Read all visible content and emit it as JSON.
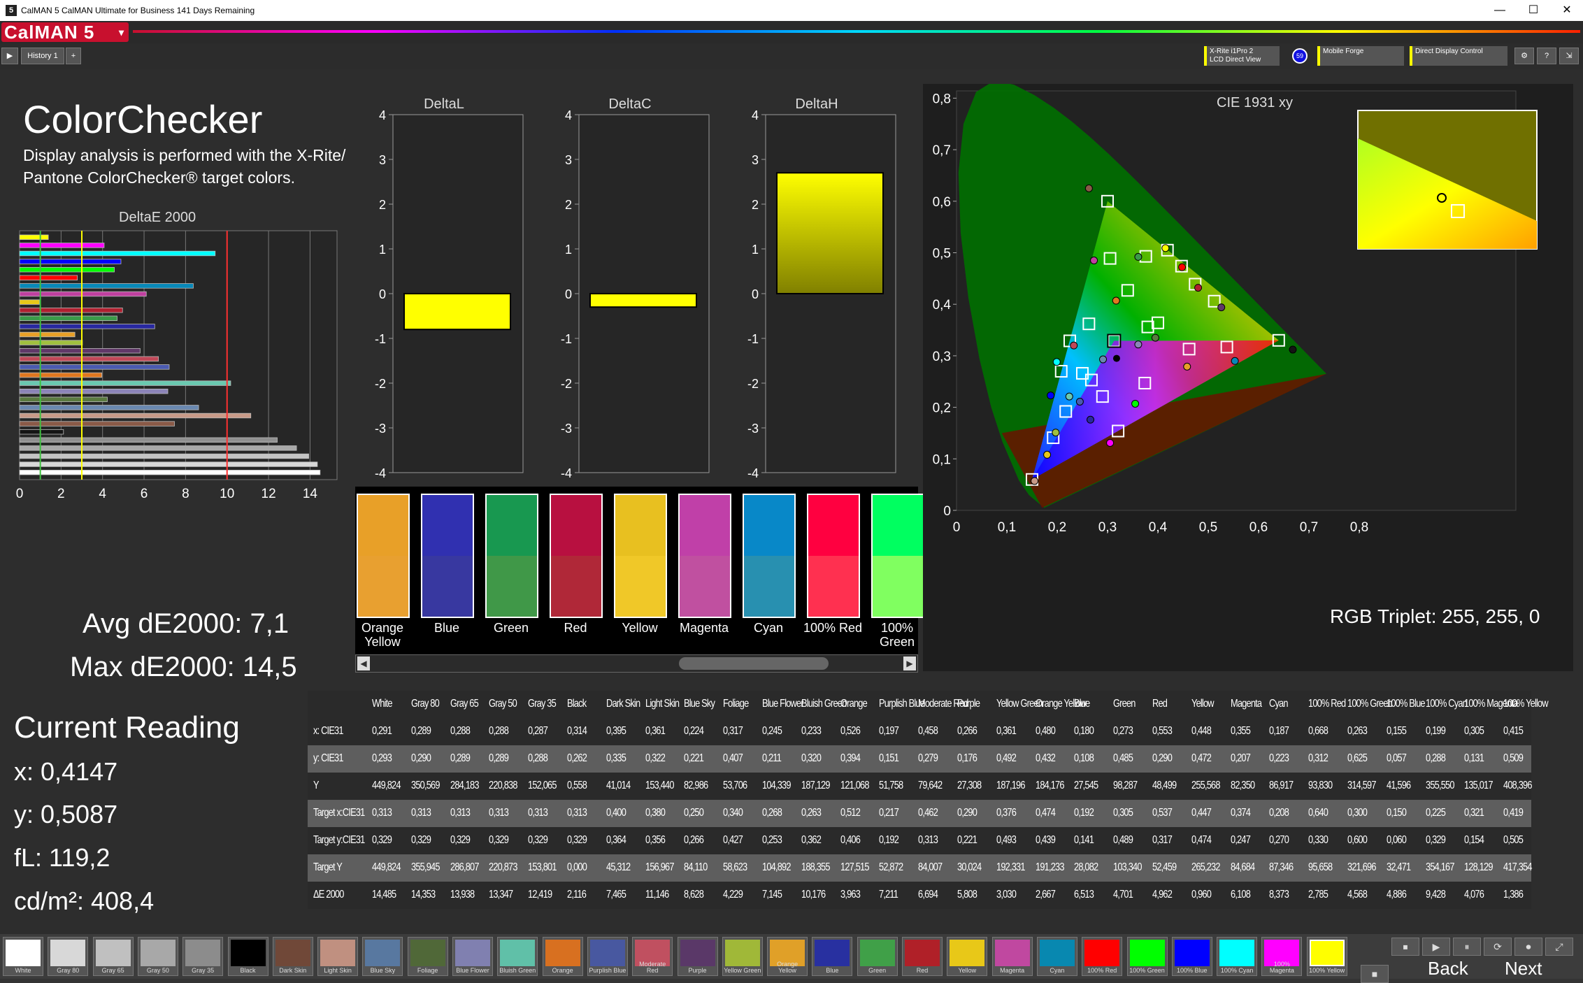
{
  "window": {
    "title": "CalMAN 5 CalMAN Ultimate for Business 141 Days Remaining",
    "minimize": "—",
    "maximize": "☐",
    "close": "✕"
  },
  "brand": {
    "name": "CalMAN 5",
    "dropdown": "▾"
  },
  "toolbar": {
    "play": "▶",
    "tab": "History 1",
    "add": "+",
    "devices": [
      {
        "line1": "X-Rite i1Pro 2",
        "line2": "LCD Direct View"
      },
      {
        "line1": "Mobile Forge",
        "line2": ""
      },
      {
        "line1": "Direct Display Control",
        "line2": ""
      }
    ],
    "badge": "59",
    "gear": "⚙",
    "help": "?",
    "pin": "⇲"
  },
  "left": {
    "title": "ColorChecker",
    "desc": "Display analysis is performed with the X-Rite/ Pantone ColorChecker® target colors.",
    "chart_title": "DeltaE 2000",
    "avg": "Avg dE2000: 7,1",
    "max": "Max dE2000: 14,5",
    "current": "Current Reading",
    "x": "x: 0,4147",
    "y": "y: 0,5087",
    "fl": "fL: 119,2",
    "cd": "cd/m²: 408,4"
  },
  "chart_data": [
    {
      "type": "bar",
      "title": "DeltaE 2000",
      "orientation": "horizontal",
      "xlim": [
        0,
        15
      ],
      "xticks": [
        0,
        2,
        4,
        6,
        8,
        10,
        12,
        14
      ],
      "reference_lines": [
        1,
        3,
        10
      ],
      "categories": [
        "White",
        "Gray 80",
        "Gray 65",
        "Gray 50",
        "Gray 35",
        "Black",
        "Dark Skin",
        "Light Skin",
        "Blue Sky",
        "Foliage",
        "Blue Flower",
        "Bluish Green",
        "Orange",
        "Purplish Blue",
        "Moderate Red",
        "Purple",
        "Yellow Green",
        "Orange Yellow",
        "Blue",
        "Green",
        "Red",
        "Yellow",
        "Magenta",
        "Cyan",
        "100% Red",
        "100% Green",
        "100% Blue",
        "100% Cyan",
        "100% Magenta",
        "100% Yellow"
      ],
      "values": [
        14.485,
        14.353,
        13.938,
        13.347,
        12.419,
        2.116,
        7.465,
        11.146,
        8.628,
        4.229,
        7.145,
        10.176,
        3.963,
        7.211,
        6.694,
        5.808,
        3.03,
        2.667,
        6.513,
        4.701,
        4.962,
        0.96,
        6.108,
        8.373,
        2.785,
        4.568,
        4.886,
        9.428,
        4.076,
        1.386
      ],
      "colors": [
        "#ffffff",
        "#d8d8d8",
        "#c4c4c4",
        "#a8a8a8",
        "#909090",
        "#141414",
        "#8a5a48",
        "#c89a88",
        "#6a88b0",
        "#5a7a40",
        "#8c84b8",
        "#6ac8b0",
        "#e07820",
        "#4a5ab0",
        "#c04858",
        "#603868",
        "#a0c040",
        "#e8a028",
        "#2828a0",
        "#3a9a48",
        "#b02030",
        "#e8c818",
        "#c040a0",
        "#0888b8",
        "#ff0000",
        "#00ff00",
        "#0000ff",
        "#00ffff",
        "#ff00ff",
        "#ffff00"
      ]
    },
    {
      "type": "bar",
      "title": "DeltaL",
      "ylim": [
        -4,
        4
      ],
      "values": [
        -0.8
      ],
      "color": "#ffff00"
    },
    {
      "type": "bar",
      "title": "DeltaC",
      "ylim": [
        -4,
        4
      ],
      "values": [
        -0.3
      ],
      "color": "#ffff00"
    },
    {
      "type": "bar",
      "title": "DeltaH",
      "ylim": [
        -4,
        4
      ],
      "values": [
        2.7
      ],
      "color": "#ffff00"
    },
    {
      "type": "scatter",
      "title": "CIE 1931 xy",
      "xlim": [
        0,
        0.8
      ],
      "ylim": [
        0,
        0.8
      ],
      "xticks": [
        "0",
        "0,1",
        "0,2",
        "0,3",
        "0,4",
        "0,5",
        "0,6",
        "0,7",
        "0,8"
      ],
      "yticks": [
        "0",
        "0,1",
        "0,2",
        "0,3",
        "0,4",
        "0,5",
        "0,6",
        "0,7",
        "0,8"
      ],
      "targets": [
        [
          0.64,
          0.33
        ],
        [
          0.3,
          0.6
        ],
        [
          0.15,
          0.06
        ],
        [
          0.313,
          0.329
        ],
        [
          0.4,
          0.364
        ],
        [
          0.38,
          0.356
        ],
        [
          0.25,
          0.266
        ],
        [
          0.34,
          0.427
        ],
        [
          0.268,
          0.253
        ],
        [
          0.263,
          0.362
        ],
        [
          0.512,
          0.406
        ],
        [
          0.217,
          0.192
        ],
        [
          0.462,
          0.313
        ],
        [
          0.29,
          0.221
        ],
        [
          0.376,
          0.493
        ],
        [
          0.474,
          0.439
        ],
        [
          0.192,
          0.141
        ],
        [
          0.305,
          0.489
        ],
        [
          0.537,
          0.317
        ],
        [
          0.447,
          0.474
        ],
        [
          0.374,
          0.247
        ],
        [
          0.208,
          0.27
        ],
        [
          0.225,
          0.329
        ],
        [
          0.321,
          0.154
        ],
        [
          0.419,
          0.505
        ]
      ],
      "measured": [
        [
          0.668,
          0.312
        ],
        [
          0.263,
          0.625
        ],
        [
          0.155,
          0.057
        ],
        [
          0.291,
          0.293
        ],
        [
          0.395,
          0.335
        ],
        [
          0.361,
          0.322
        ],
        [
          0.224,
          0.221
        ],
        [
          0.317,
          0.407
        ],
        [
          0.245,
          0.211
        ],
        [
          0.233,
          0.32
        ],
        [
          0.526,
          0.394
        ],
        [
          0.197,
          0.151
        ],
        [
          0.458,
          0.279
        ],
        [
          0.266,
          0.176
        ],
        [
          0.361,
          0.492
        ],
        [
          0.48,
          0.432
        ],
        [
          0.18,
          0.108
        ],
        [
          0.273,
          0.485
        ],
        [
          0.553,
          0.29
        ],
        [
          0.448,
          0.472
        ],
        [
          0.355,
          0.207
        ],
        [
          0.187,
          0.223
        ],
        [
          0.199,
          0.288
        ],
        [
          0.305,
          0.131
        ],
        [
          0.415,
          0.509
        ]
      ],
      "current": [
        0.4147,
        0.5087
      ],
      "triplet": "RGB Triplet: 255, 255, 0"
    }
  ],
  "delta_titles": [
    "DeltaL",
    "DeltaC",
    "DeltaH"
  ],
  "delta_ticks": [
    "4",
    "3",
    "2",
    "1",
    "0",
    "-1",
    "-2",
    "-3",
    "-4"
  ],
  "swatches": [
    {
      "label": "Orange Yellow",
      "top": "#e8a028",
      "bot": "#e8a030"
    },
    {
      "label": "Blue",
      "top": "#3030b0",
      "bot": "#3838a0"
    },
    {
      "label": "Green",
      "top": "#189850",
      "bot": "#409848"
    },
    {
      "label": "Red",
      "top": "#b81040",
      "bot": "#b02838"
    },
    {
      "label": "Yellow",
      "top": "#e8c020",
      "bot": "#f0c828"
    },
    {
      "label": "Magenta",
      "top": "#c040a8",
      "bot": "#c050a0"
    },
    {
      "label": "Cyan",
      "top": "#0888c8",
      "bot": "#2890b0"
    },
    {
      "label": "100% Red",
      "top": "#ff0040",
      "bot": "#ff3050"
    },
    {
      "label": "100% Green",
      "top": "#00ff60",
      "bot": "#80ff60"
    }
  ],
  "table": {
    "headers": [
      "White",
      "Gray 80",
      "Gray 65",
      "Gray 50",
      "Gray 35",
      "Black",
      "Dark Skin",
      "Light Skin",
      "Blue Sky",
      "Foliage",
      "Blue Flower",
      "Bluish Green",
      "Orange",
      "Purplish Blue",
      "Moderate Red",
      "Purple",
      "Yellow Green",
      "Orange Yellow",
      "Blue",
      "Green",
      "Red",
      "Yellow",
      "Magenta",
      "Cyan",
      "100% Red",
      "100% Green",
      "100% Blue",
      "100% Cyan",
      "100% Magenta",
      "100% Yellow"
    ],
    "rows": [
      {
        "label": "x: CIE31",
        "values": [
          "0,291",
          "0,289",
          "0,288",
          "0,288",
          "0,287",
          "0,314",
          "0,395",
          "0,361",
          "0,224",
          "0,317",
          "0,245",
          "0,233",
          "0,526",
          "0,197",
          "0,458",
          "0,266",
          "0,361",
          "0,480",
          "0,180",
          "0,273",
          "0,553",
          "0,448",
          "0,355",
          "0,187",
          "0,668",
          "0,263",
          "0,155",
          "0,199",
          "0,305",
          "0,415"
        ]
      },
      {
        "label": "y: CIE31",
        "values": [
          "0,293",
          "0,290",
          "0,289",
          "0,289",
          "0,288",
          "0,262",
          "0,335",
          "0,322",
          "0,221",
          "0,407",
          "0,211",
          "0,320",
          "0,394",
          "0,151",
          "0,279",
          "0,176",
          "0,492",
          "0,432",
          "0,108",
          "0,485",
          "0,290",
          "0,472",
          "0,207",
          "0,223",
          "0,312",
          "0,625",
          "0,057",
          "0,288",
          "0,131",
          "0,509"
        ]
      },
      {
        "label": "Y",
        "values": [
          "449,824",
          "350,569",
          "284,183",
          "220,838",
          "152,065",
          "0,558",
          "41,014",
          "153,440",
          "82,986",
          "53,706",
          "104,339",
          "187,129",
          "121,068",
          "51,758",
          "79,642",
          "27,308",
          "187,196",
          "184,176",
          "27,545",
          "98,287",
          "48,499",
          "255,568",
          "82,350",
          "86,917",
          "93,830",
          "314,597",
          "41,596",
          "355,550",
          "135,017",
          "408,396"
        ]
      },
      {
        "label": "Target x:CIE31",
        "values": [
          "0,313",
          "0,313",
          "0,313",
          "0,313",
          "0,313",
          "0,313",
          "0,400",
          "0,380",
          "0,250",
          "0,340",
          "0,268",
          "0,263",
          "0,512",
          "0,217",
          "0,462",
          "0,290",
          "0,376",
          "0,474",
          "0,192",
          "0,305",
          "0,537",
          "0,447",
          "0,374",
          "0,208",
          "0,640",
          "0,300",
          "0,150",
          "0,225",
          "0,321",
          "0,419"
        ]
      },
      {
        "label": "Target y:CIE31",
        "values": [
          "0,329",
          "0,329",
          "0,329",
          "0,329",
          "0,329",
          "0,329",
          "0,364",
          "0,356",
          "0,266",
          "0,427",
          "0,253",
          "0,362",
          "0,406",
          "0,192",
          "0,313",
          "0,221",
          "0,493",
          "0,439",
          "0,141",
          "0,489",
          "0,317",
          "0,474",
          "0,247",
          "0,270",
          "0,330",
          "0,600",
          "0,060",
          "0,329",
          "0,154",
          "0,505"
        ]
      },
      {
        "label": "Target Y",
        "values": [
          "449,824",
          "355,945",
          "286,807",
          "220,873",
          "153,801",
          "0,000",
          "45,312",
          "156,967",
          "84,110",
          "58,623",
          "104,892",
          "188,355",
          "127,515",
          "52,872",
          "84,007",
          "30,024",
          "192,331",
          "191,233",
          "28,082",
          "103,340",
          "52,459",
          "265,232",
          "84,684",
          "87,346",
          "95,658",
          "321,696",
          "32,471",
          "354,167",
          "128,129",
          "417,354"
        ]
      },
      {
        "label": "ΔE 2000",
        "values": [
          "14,485",
          "14,353",
          "13,938",
          "13,347",
          "12,419",
          "2,116",
          "7,465",
          "11,146",
          "8,628",
          "4,229",
          "7,145",
          "10,176",
          "3,963",
          "7,211",
          "6,694",
          "5,808",
          "3,030",
          "2,667",
          "6,513",
          "4,701",
          "4,962",
          "0,960",
          "6,108",
          "8,373",
          "2,785",
          "4,568",
          "4,886",
          "9,428",
          "4,076",
          "1,386"
        ]
      }
    ]
  },
  "patches": [
    {
      "label": "White",
      "color": "#ffffff"
    },
    {
      "label": "Gray 80",
      "color": "#d8d8d8"
    },
    {
      "label": "Gray 65",
      "color": "#c0c0c0"
    },
    {
      "label": "Gray 50",
      "color": "#a8a8a8"
    },
    {
      "label": "Gray 35",
      "color": "#8c8c8c"
    },
    {
      "label": "Black",
      "color": "#000000"
    },
    {
      "label": "Dark Skin",
      "color": "#704838"
    },
    {
      "label": "Light Skin",
      "color": "#c09080"
    },
    {
      "label": "Blue Sky",
      "color": "#5878a0"
    },
    {
      "label": "Foliage",
      "color": "#506838"
    },
    {
      "label": "Blue Flower",
      "color": "#8080b0"
    },
    {
      "label": "Bluish Green",
      "color": "#60c0a8"
    },
    {
      "label": "Orange",
      "color": "#d87020"
    },
    {
      "label": "Purplish Blue",
      "color": "#4858a0"
    },
    {
      "label": "Moderate Red",
      "color": "#c05060"
    },
    {
      "label": "Purple",
      "color": "#5a3868"
    },
    {
      "label": "Yellow Green",
      "color": "#a0b838"
    },
    {
      "label": "Orange Yellow",
      "color": "#e0a028"
    },
    {
      "label": "Blue",
      "color": "#2830a0"
    },
    {
      "label": "Green",
      "color": "#40a048"
    },
    {
      "label": "Red",
      "color": "#b02028"
    },
    {
      "label": "Yellow",
      "color": "#e8c818"
    },
    {
      "label": "Magenta",
      "color": "#c048a0"
    },
    {
      "label": "Cyan",
      "color": "#0888b0"
    },
    {
      "label": "100% Red",
      "color": "#ff0000"
    },
    {
      "label": "100% Green",
      "color": "#00ff00"
    },
    {
      "label": "100% Blue",
      "color": "#0000ff"
    },
    {
      "label": "100% Cyan",
      "color": "#00ffff"
    },
    {
      "label": "100% Magenta",
      "color": "#ff00ff"
    },
    {
      "label": "100% Yellow",
      "color": "#ffff00"
    }
  ],
  "nav": {
    "back": "Back",
    "next": "Next"
  },
  "controls": [
    "■",
    "⏹",
    "▶",
    "⏸",
    "⟳",
    "⏺",
    "⤢"
  ]
}
